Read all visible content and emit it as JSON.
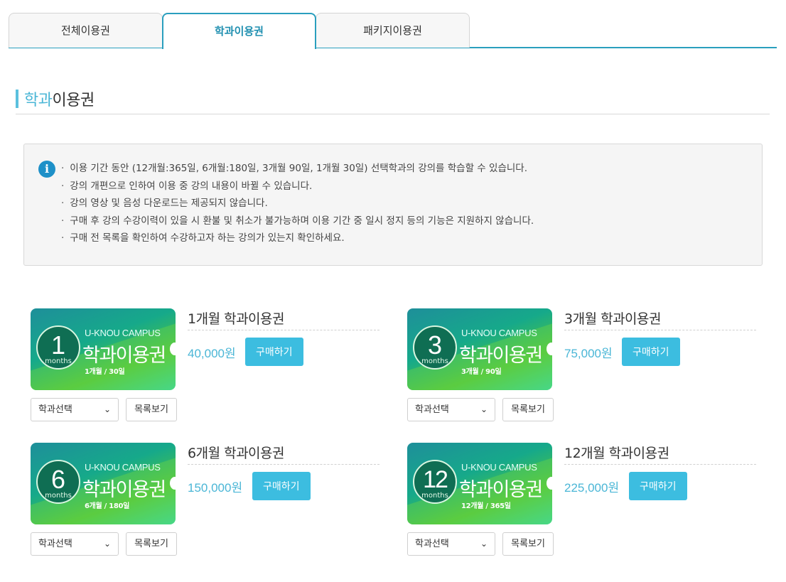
{
  "tabs": [
    {
      "label": "전체이용권",
      "active": false
    },
    {
      "label": "학과이용권",
      "active": true
    },
    {
      "label": "패키지이용권",
      "active": false
    }
  ],
  "section": {
    "title_highlight": "학과",
    "title_rest": "이용권"
  },
  "notice": {
    "icon": "info-icon",
    "items": [
      "이용 기간 동안 (12개월:365일, 6개월:180일, 3개월 90일, 1개월 30일) 선택학과의 강의를 학습할 수 있습니다.",
      "강의 개편으로 인하여 이용 중 강의 내용이 바뀔 수 있습니다.",
      "강의 영상 및 음성 다운로드는 제공되지 않습니다.",
      "구매 후 강의 수강이력이 있을 시 환불 및 취소가 불가능하며 이용 기간 중 일시 정지 등의 기능은 지원하지 않습니다.",
      "구매 전 목록을 확인하여 수강하고자 하는 강의가 있는지 확인하세요."
    ]
  },
  "products": [
    {
      "num": "1",
      "months_label": "months",
      "campus": "U-KNOU CAMPUS",
      "badge_title": "학과이용권",
      "badge_sub": "1개월 / 30일",
      "title": "1개월 학과이용권",
      "price": "40,000원",
      "buy_label": "구매하기",
      "select_value": "학과선택",
      "list_label": "목록보기"
    },
    {
      "num": "3",
      "months_label": "months",
      "campus": "U-KNOU CAMPUS",
      "badge_title": "학과이용권",
      "badge_sub": "3개월 / 90일",
      "title": "3개월 학과이용권",
      "price": "75,000원",
      "buy_label": "구매하기",
      "select_value": "학과선택",
      "list_label": "목록보기"
    },
    {
      "num": "6",
      "months_label": "months",
      "campus": "U-KNOU CAMPUS",
      "badge_title": "학과이용권",
      "badge_sub": "6개월 / 180일",
      "title": "6개월 학과이용권",
      "price": "150,000원",
      "buy_label": "구매하기",
      "select_value": "학과선택",
      "list_label": "목록보기"
    },
    {
      "num": "12",
      "months_label": "months",
      "campus": "U-KNOU CAMPUS",
      "badge_title": "학과이용권",
      "badge_sub": "12개월 / 365일",
      "title": "12개월 학과이용권",
      "price": "225,000원",
      "buy_label": "구매하기",
      "select_value": "학과선택",
      "list_label": "목록보기"
    }
  ],
  "colors": {
    "accent": "#2a9fbe",
    "price": "#4ab6d6",
    "button": "#3cbde0",
    "info": "#1e90c8"
  }
}
